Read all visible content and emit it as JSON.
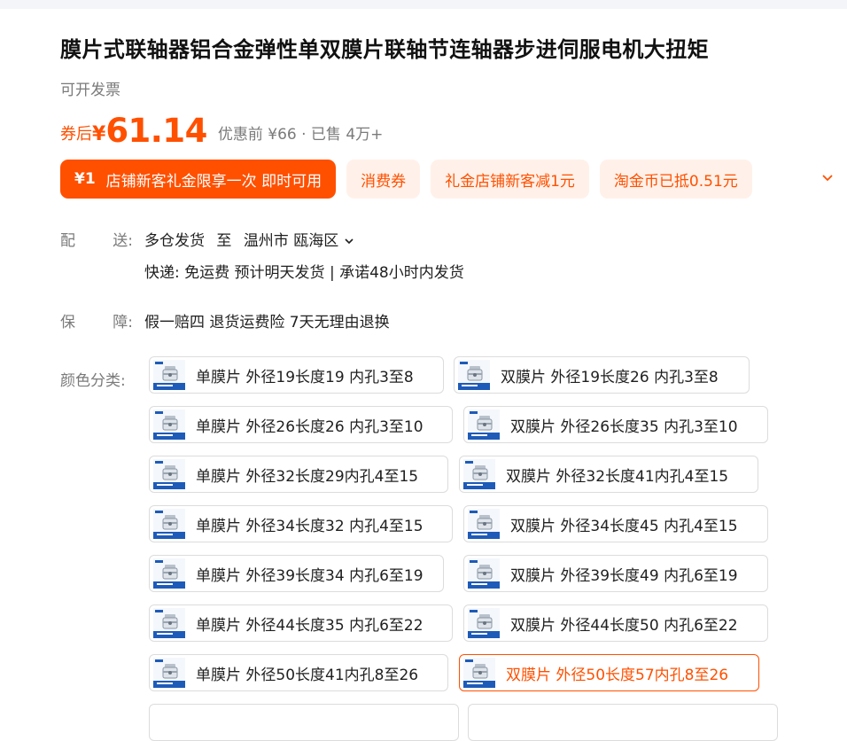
{
  "product": {
    "title": "膜片式联轴器铝合金弹性单双膜片联轴节连轴器步进伺服电机大扭矩",
    "invoice": "可开发票"
  },
  "price": {
    "coupon_tag": "券后",
    "currency": "¥",
    "value": "61.14",
    "meta": "优惠前 ¥66 · 已售 4万+"
  },
  "coupons": [
    {
      "amount": "¥1",
      "text": "店铺新客礼金限享一次 即时可用",
      "style": "primary"
    },
    {
      "amount": "",
      "text": "消费券",
      "style": "soft"
    },
    {
      "amount": "",
      "text": "礼金店铺新客减1元",
      "style": "soft"
    },
    {
      "amount": "",
      "text": "淘金币已抵0.51元",
      "style": "soft"
    }
  ],
  "delivery": {
    "label_left": "配",
    "label_right": "送:",
    "from": "多仓发货",
    "to_word": "至",
    "location": "温州市 瓯海区",
    "line2": "快递: 免运费  预计明天发货 | 承诺48小时内发货"
  },
  "guarantee": {
    "label_left": "保",
    "label_right": "障:",
    "text": "假一赔四 退货运费险 7天无理由退换"
  },
  "colors": {
    "label": "颜色分类:",
    "options": [
      {
        "text": "单膜片 外径19长度19 内孔3至8",
        "selected": false
      },
      {
        "text": "双膜片 外径19长度26 内孔3至8",
        "selected": false
      },
      {
        "text": "单膜片 外径26长度26 内孔3至10",
        "selected": false
      },
      {
        "text": "双膜片 外径26长度35 内孔3至10",
        "selected": false
      },
      {
        "text": "单膜片 外径32长度29内孔4至15",
        "selected": false
      },
      {
        "text": "双膜片 外径32长度41内孔4至15",
        "selected": false
      },
      {
        "text": "单膜片 外径34长度32 内孔4至15",
        "selected": false
      },
      {
        "text": "双膜片 外径34长度45 内孔4至15",
        "selected": false
      },
      {
        "text": "单膜片 外径39长度34 内孔6至19",
        "selected": false
      },
      {
        "text": "双膜片 外径39长度49 内孔6至19",
        "selected": false
      },
      {
        "text": "单膜片 外径44长度35 内孔6至22",
        "selected": false
      },
      {
        "text": "双膜片 外径44长度50 内孔6至22",
        "selected": false
      },
      {
        "text": "单膜片 外径50长度41内孔8至26",
        "selected": false
      },
      {
        "text": "双膜片 外径50长度57内孔8至26",
        "selected": true
      }
    ]
  },
  "theme": {
    "accent": "#ff5000",
    "accent_soft": "#fff1e9"
  }
}
